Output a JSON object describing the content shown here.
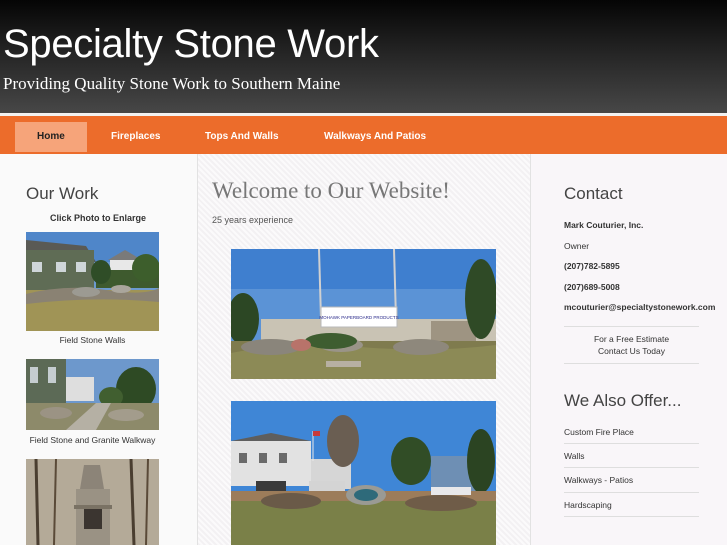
{
  "header": {
    "title": "Specialty Stone Work",
    "tagline": "Providing Quality Stone Work to Southern Maine"
  },
  "nav": {
    "items": [
      {
        "label": "Home"
      },
      {
        "label": "Fireplaces"
      },
      {
        "label": "Tops And Walls"
      },
      {
        "label": "Walkways And Patios"
      }
    ]
  },
  "left": {
    "heading": "Our Work",
    "subheading": "Click Photo to Enlarge",
    "photos": [
      {
        "caption": "Field Stone Walls"
      },
      {
        "caption": "Field Stone and Granite Walkway"
      }
    ]
  },
  "main": {
    "heading": "Welcome to Our Website!",
    "experience": "25 years experience",
    "photo1_sign": "MOHAWK PAPERBOARD PRODUCTS"
  },
  "right": {
    "contact_heading": "Contact",
    "company": "Mark Couturier, Inc.",
    "role": "Owner",
    "phone1": "(207)782-5895",
    "phone2": "(207)689-5008",
    "email": "mcouturier@specialtystonework.com",
    "estimate_line1": "For a Free Estimate",
    "estimate_line2": "Contact Us Today",
    "offer_heading": "We Also Offer...",
    "offers": [
      {
        "label": "Custom Fire Place"
      },
      {
        "label": "Walls"
      },
      {
        "label": "Walkways - Patios"
      },
      {
        "label": "Hardscaping"
      }
    ]
  },
  "colors": {
    "nav_orange": "#ec6c2b",
    "nav_active": "#f6a47a",
    "header_dark": "#1a1a1a"
  }
}
